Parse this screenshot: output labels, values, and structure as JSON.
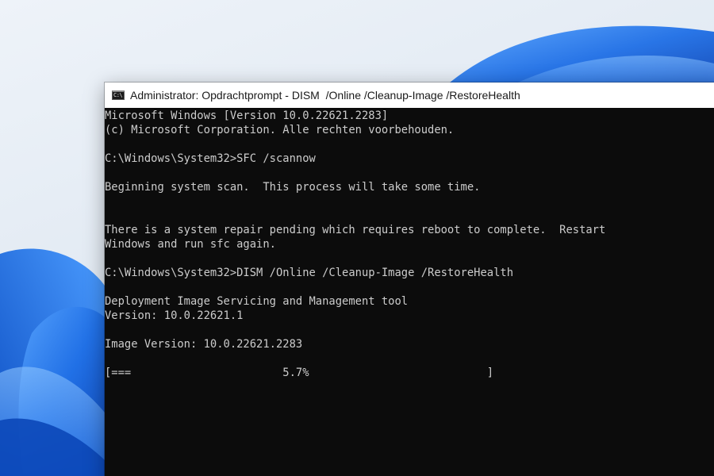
{
  "window": {
    "title": "Administrator: Opdrachtprompt - DISM  /Online /Cleanup-Image /RestoreHealth",
    "icon": "command-prompt-icon"
  },
  "console": {
    "lines": [
      "Microsoft Windows [Version 10.0.22621.2283]",
      "(c) Microsoft Corporation. Alle rechten voorbehouden.",
      "",
      "C:\\Windows\\System32>SFC /scannow",
      "",
      "Beginning system scan.  This process will take some time.",
      "",
      "",
      "There is a system repair pending which requires reboot to complete.  Restart",
      "Windows and run sfc again.",
      "",
      "C:\\Windows\\System32>DISM /Online /Cleanup-Image /RestoreHealth",
      "",
      "Deployment Image Servicing and Management tool",
      "Version: 10.0.22621.1",
      "",
      "Image Version: 10.0.22621.2283",
      "",
      "[===                       5.7%                           ]"
    ],
    "progress_percent": 5.7
  },
  "colors": {
    "console_background": "#0c0c0c",
    "console_text": "#cccccc",
    "title_bar": "#ffffff",
    "wallpaper_accent": "#1a6fe0"
  }
}
